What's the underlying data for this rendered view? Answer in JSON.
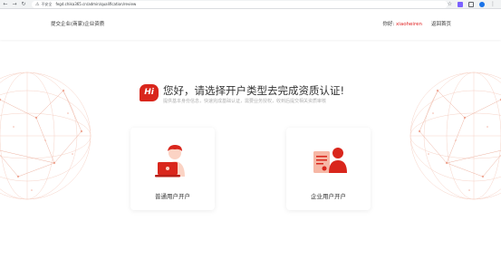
{
  "browser": {
    "security_label": "不安全",
    "url": "fegd.chika365.cn/admin/qualification/review"
  },
  "header": {
    "title": "提交企业(商家)企业资质",
    "greeting_label": "你好:",
    "username": "xiaoheiren",
    "home_link": "返回首页"
  },
  "main": {
    "hi_badge": "Hi",
    "headline": "您好，请选择开户类型去完成资质认证!",
    "subline": "提供基本身份信息，快速完成基础认证，需要业务授权，收到后提交相关资质审核"
  },
  "cards": [
    {
      "label": "普通用户开户",
      "icon": "personal-user-laptop-icon"
    },
    {
      "label": "企业用户开户",
      "icon": "enterprise-user-certificate-icon"
    }
  ],
  "colors": {
    "accent_red": "#d9261c",
    "username_red": "#e02020"
  }
}
